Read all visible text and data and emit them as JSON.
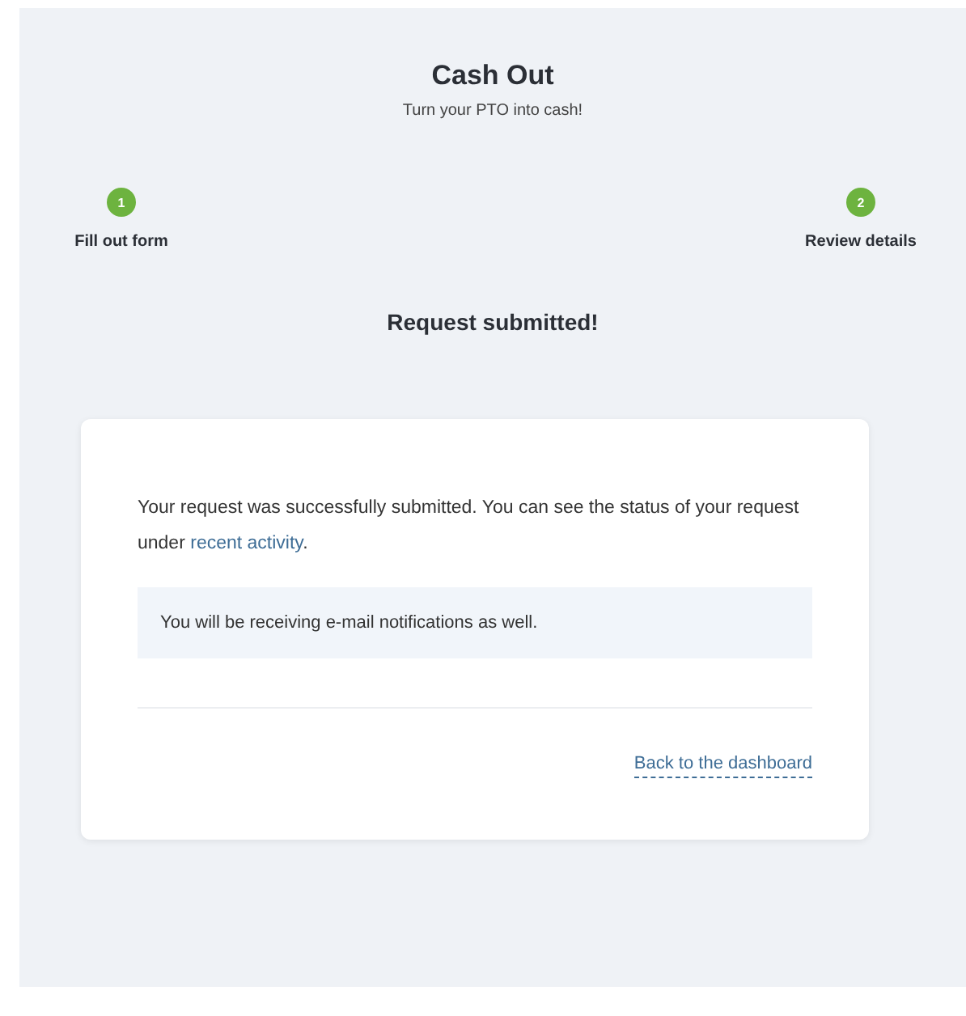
{
  "header": {
    "title": "Cash Out",
    "subtitle": "Turn your PTO into cash!"
  },
  "steps": [
    {
      "number": "1",
      "label": "Fill out form",
      "completed": true
    },
    {
      "number": "2",
      "label": "Review details",
      "completed": true
    }
  ],
  "status_title": "Request submitted!",
  "card": {
    "message": {
      "before": "Your request was successfully submitted. You can see the status of your request under ",
      "link": "recent activity",
      "after": "."
    },
    "notice": "You will be receiving e-mail notifications as well.",
    "back_link": "Back to the dashboard"
  }
}
